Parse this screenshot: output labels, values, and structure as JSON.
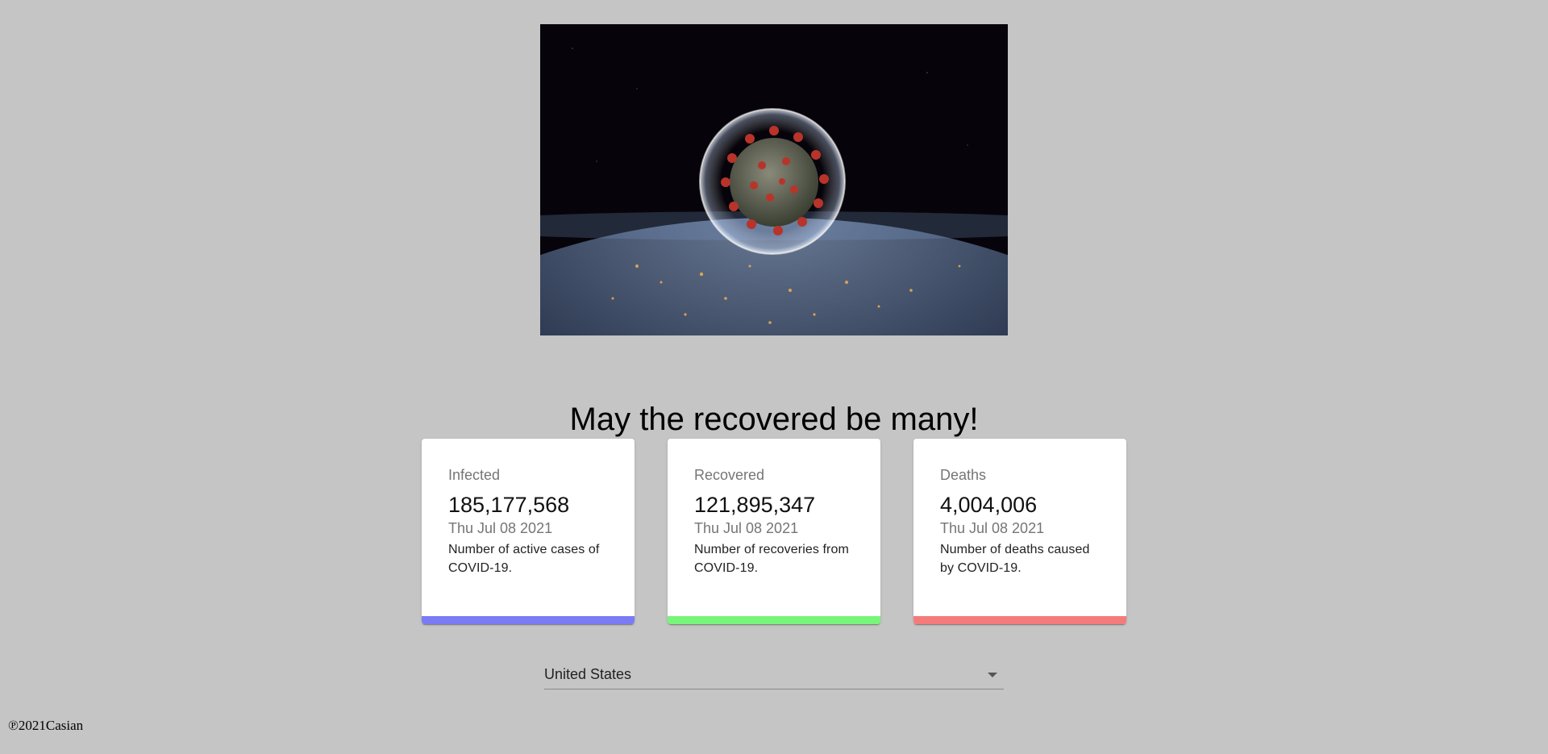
{
  "headline": "May the recovered be many!",
  "hero": {
    "icon": "virus-over-earth-image"
  },
  "cards": [
    {
      "title": "Infected",
      "value": "185,177,568",
      "date": "Thu Jul 08 2021",
      "description": "Number of active cases of COVID-19.",
      "color": "#7b7bf5"
    },
    {
      "title": "Recovered",
      "value": "121,895,347",
      "date": "Thu Jul 08 2021",
      "description": "Number of recoveries from COVID-19.",
      "color": "#78f57b"
    },
    {
      "title": "Deaths",
      "value": "4,004,006",
      "date": "Thu Jul 08 2021",
      "description": "Number of deaths caused by COVID-19.",
      "color": "#f57b7b"
    }
  ],
  "country_select": {
    "selected": "United States",
    "icon": "chevron-down-icon"
  },
  "footer": {
    "text": "℗2021Casian"
  }
}
